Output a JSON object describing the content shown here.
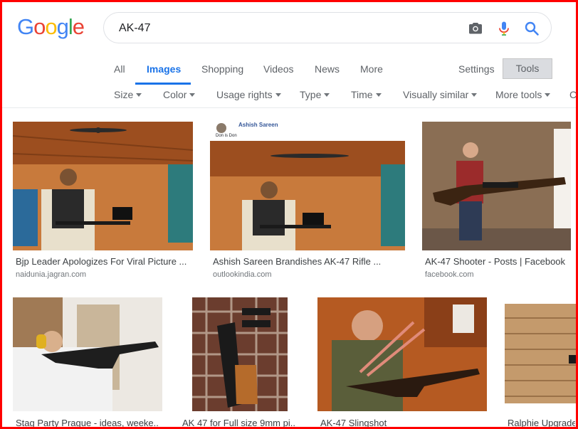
{
  "brand": {
    "logo_letters": [
      "G",
      "o",
      "o",
      "g",
      "l",
      "e"
    ],
    "logo_colors": [
      "#4285F4",
      "#EA4335",
      "#FBBC05",
      "#4285F4",
      "#34A853",
      "#EA4335"
    ]
  },
  "search": {
    "query": "AK-47"
  },
  "tabs": [
    {
      "label": "All"
    },
    {
      "label": "Images"
    },
    {
      "label": "Shopping"
    },
    {
      "label": "Videos"
    },
    {
      "label": "News"
    },
    {
      "label": "More"
    }
  ],
  "settings_label": "Settings",
  "tools_label": "Tools",
  "filters": [
    {
      "label": "Size"
    },
    {
      "label": "Color"
    },
    {
      "label": "Usage rights"
    },
    {
      "label": "Type"
    },
    {
      "label": "Time"
    },
    {
      "label": "Visually similar"
    },
    {
      "label": "More tools"
    },
    {
      "label": "C"
    }
  ],
  "results": [
    {
      "caption": "Bjp Leader Apologizes For Viral Picture ...",
      "source": "naidunia.jagran.com"
    },
    {
      "caption": "Ashish Sareen Brandishes AK-47 Rifle ...",
      "source": "outlookindia.com",
      "overlay_name": "Ashish Sareen",
      "overlay_sub": "Don is Don"
    },
    {
      "caption": "AK-47 Shooter - Posts | Facebook",
      "source": "facebook.com"
    },
    {
      "caption": "Stag Party Prague - ideas, weeke..."
    },
    {
      "caption": "AK 47 for Full size 9mm pi..."
    },
    {
      "caption": "AK-47 Slingshot"
    },
    {
      "caption": "Ralphie Upgrade..."
    }
  ],
  "icons": {
    "camera": "camera-icon",
    "mic": "mic-icon",
    "search": "search-icon"
  },
  "accent": "#1a73e8"
}
